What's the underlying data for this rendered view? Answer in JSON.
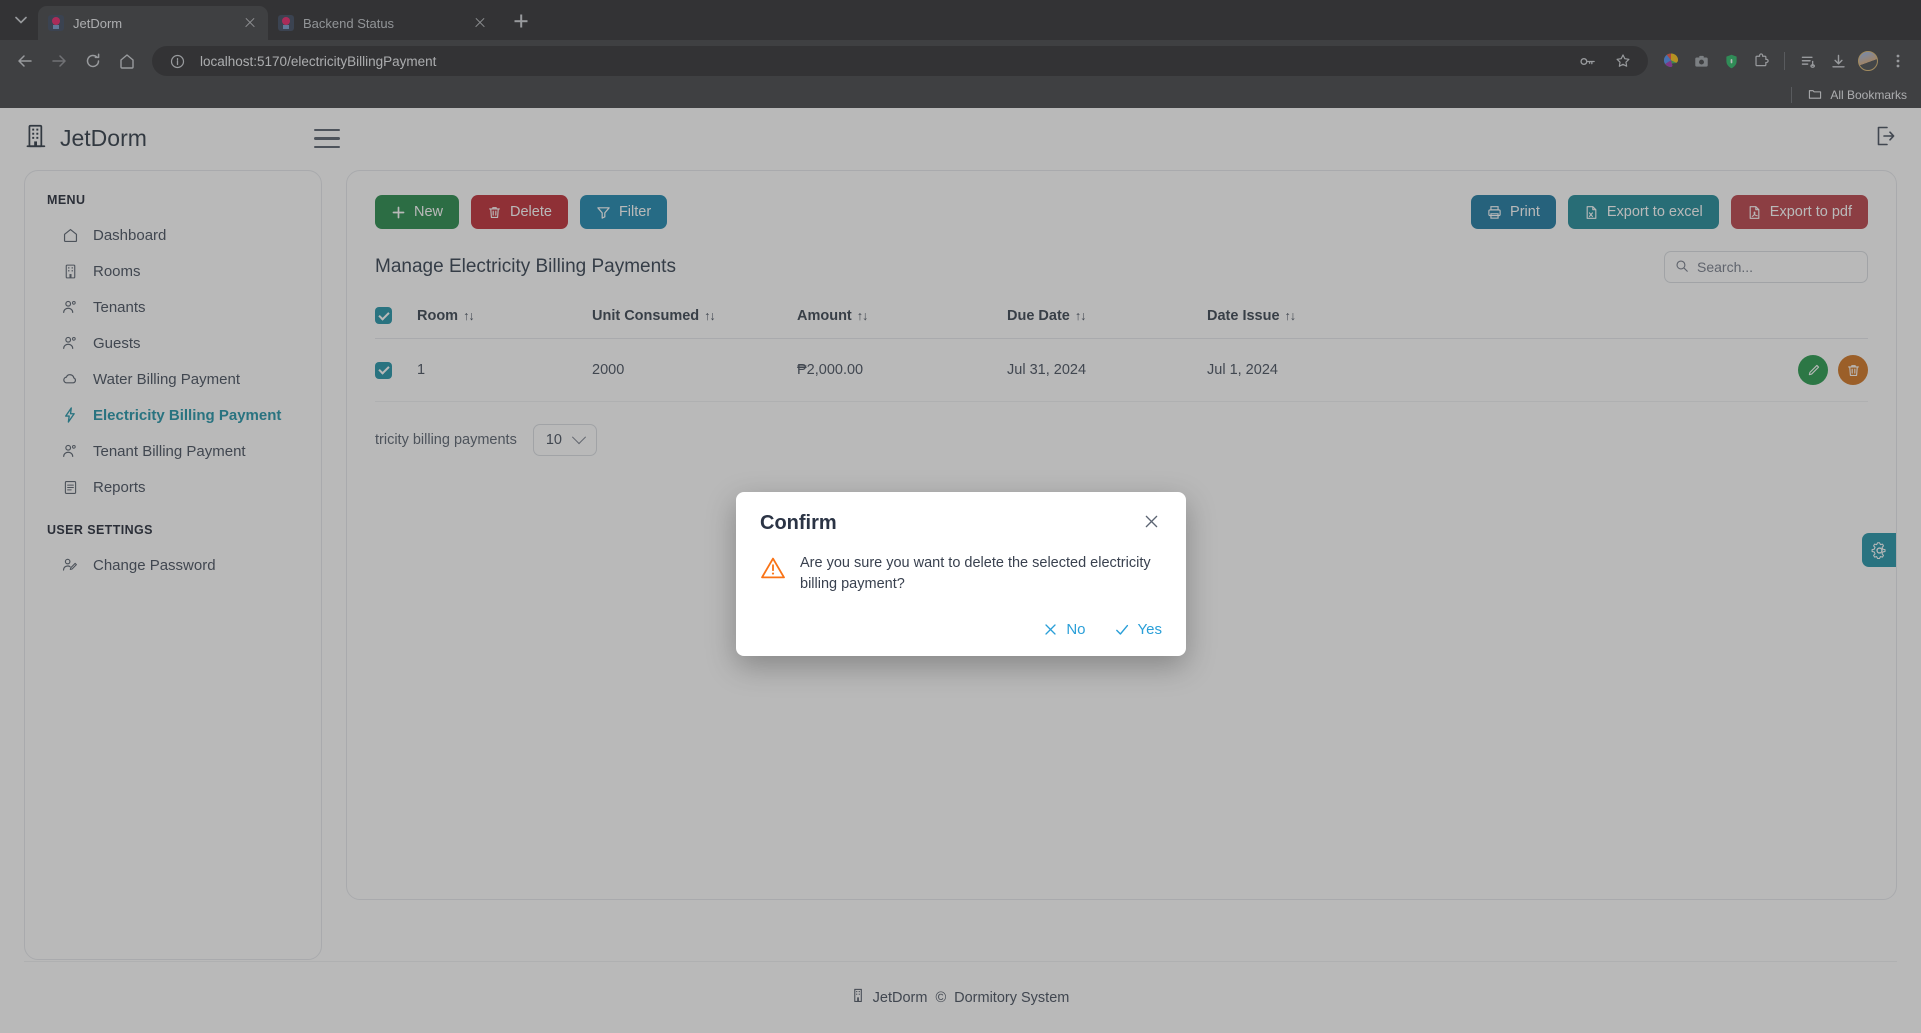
{
  "browser": {
    "tabs": [
      {
        "title": "JetDorm",
        "active": true
      },
      {
        "title": "Backend Status",
        "active": false
      }
    ],
    "url": "localhost:5170/electricityBillingPayment",
    "bookmarks_label": "All Bookmarks"
  },
  "app": {
    "brand": "JetDorm",
    "footer_brand": "JetDorm",
    "footer_copy": "©",
    "footer_text": "Dormitory System"
  },
  "sidebar": {
    "menu_label": "MENU",
    "items": [
      {
        "label": "Dashboard",
        "icon": "home-icon",
        "active": false
      },
      {
        "label": "Rooms",
        "icon": "building-icon",
        "active": false
      },
      {
        "label": "Tenants",
        "icon": "users-icon",
        "active": false
      },
      {
        "label": "Guests",
        "icon": "users-icon",
        "active": false
      },
      {
        "label": "Water Billing Payment",
        "icon": "cloud-icon",
        "active": false
      },
      {
        "label": "Electricity Billing Payment",
        "icon": "bolt-icon",
        "active": true
      },
      {
        "label": "Tenant Billing Payment",
        "icon": "users-icon",
        "active": false
      },
      {
        "label": "Reports",
        "icon": "report-icon",
        "active": false
      }
    ],
    "user_settings_label": "USER SETTINGS",
    "user_items": [
      {
        "label": "Change Password",
        "icon": "user-edit-icon"
      }
    ]
  },
  "toolbar": {
    "new_label": "New",
    "delete_label": "Delete",
    "filter_label": "Filter",
    "print_label": "Print",
    "export_excel_label": "Export to excel",
    "export_pdf_label": "Export to pdf"
  },
  "main": {
    "page_title": "Manage Electricity Billing Payments",
    "search_placeholder": "Search...",
    "search_value": ""
  },
  "table": {
    "sort_glyph": "↑↓",
    "columns": [
      "Room",
      "Unit Consumed",
      "Amount",
      "Due Date",
      "Date Issue"
    ],
    "rows": [
      {
        "selected": true,
        "room": "1",
        "unit_consumed": "2000",
        "amount": "₱2,000.00",
        "due_date": "Jul 31, 2024",
        "date_issue": "Jul 1, 2024"
      }
    ],
    "header_checkbox_checked": true
  },
  "pagination": {
    "summary": "tricity billing payments",
    "page_size": "10"
  },
  "modal": {
    "title": "Confirm",
    "message": "Are you sure you want to delete the selected electricity billing payment?",
    "no_label": "No",
    "yes_label": "Yes"
  },
  "colors": {
    "accent": "#0f8ba0",
    "new": "#15803d",
    "delete": "#b91c26",
    "filter": "#0a7ea8",
    "print": "#0a6e99",
    "excel": "#0e8090",
    "pdf": "#b5333b",
    "edit_circle": "#14923f",
    "delete_circle": "#cd6a10",
    "modal_link": "#2a9fd8",
    "warning": "#f97316"
  }
}
